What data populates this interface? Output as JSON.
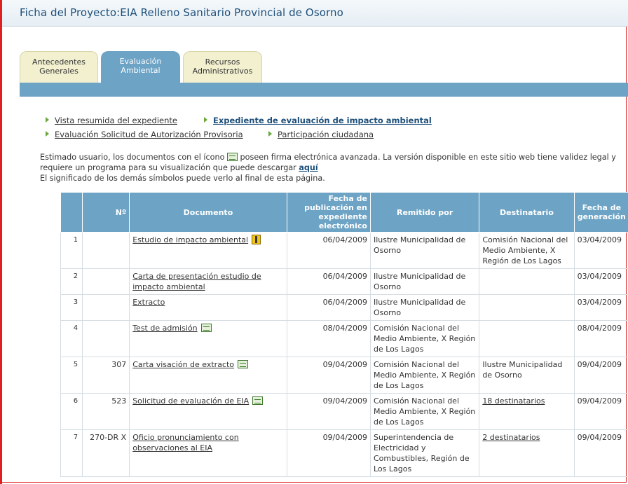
{
  "page": {
    "title": "Ficha del Proyecto:EIA Relleno Sanitario Provincial de Osorno"
  },
  "tabs": [
    {
      "line1": "Antecedentes",
      "line2": "Generales"
    },
    {
      "line1": "Evaluación",
      "line2": "Ambiental"
    },
    {
      "line1": "Recursos",
      "line2": "Administrativos"
    }
  ],
  "links": {
    "vista_resumida": "Vista resumida del expediente",
    "expediente": "Expediente de evaluación de impacto ambiental",
    "solicitud": "Evaluación Solicitud de Autorización Provisoria",
    "participacion": "Participación ciudadana"
  },
  "notice": {
    "part1": "Estimado usuario, los documentos con el ícono",
    "part2": "poseen firma electrónica avanzada. La versión disponible en este sitio web tiene validez legal y requiere un programa para su visualización que puede descargar",
    "aqui": "aquí",
    "line2": "El significado de los demás símbolos puede verlo al final de esta página."
  },
  "table": {
    "headers": [
      "",
      "Nº",
      "Documento",
      "Fecha de publicación en expediente electrónico",
      "Remitido por",
      "Destinatario",
      "Fecha de generación"
    ],
    "rows": [
      {
        "idx": "1",
        "num": "",
        "doc": "Estudio de impacto ambiental",
        "icon": "folder-icon",
        "pub": "06/04/2009",
        "from": "Ilustre Municipalidad de Osorno",
        "to": "Comisión Nacional del Medio Ambiente, X Región de Los Lagos",
        "to_link": false,
        "gen": "03/04/2009"
      },
      {
        "idx": "2",
        "num": "",
        "doc": "Carta de presentación estudio de impacto ambiental",
        "icon": "",
        "pub": "06/04/2009",
        "from": "Ilustre Municipalidad de Osorno",
        "to": "",
        "to_link": false,
        "gen": "03/04/2009"
      },
      {
        "idx": "3",
        "num": "",
        "doc": "Extracto",
        "icon": "",
        "pub": "06/04/2009",
        "from": "Ilustre Municipalidad de Osorno",
        "to": "",
        "to_link": false,
        "gen": "03/04/2009"
      },
      {
        "idx": "4",
        "num": "",
        "doc": "Test de admisión",
        "icon": "signature-icon",
        "pub": "08/04/2009",
        "from": "Comisión Nacional del Medio Ambiente, X Región de Los Lagos",
        "to": "",
        "to_link": false,
        "gen": "08/04/2009"
      },
      {
        "idx": "5",
        "num": "307",
        "doc": "Carta visación de extracto",
        "icon": "signature-icon",
        "pub": "09/04/2009",
        "from": "Comisión Nacional del Medio Ambiente, X Región de Los Lagos",
        "to": "Ilustre Municipalidad de Osorno",
        "to_link": false,
        "gen": "09/04/2009"
      },
      {
        "idx": "6",
        "num": "523",
        "doc": "Solicitud de evaluación de EIA",
        "icon": "signature-icon",
        "pub": "09/04/2009",
        "from": "Comisión Nacional del Medio Ambiente, X Región de Los Lagos",
        "to": "18 destinatarios",
        "to_link": true,
        "gen": "09/04/2009"
      },
      {
        "idx": "7",
        "num": "270-DR X",
        "doc": "Oficio pronunciamiento con observaciones al EIA",
        "icon": "",
        "pub": "09/04/2009",
        "from": "Superintendencia de Electricidad y Combustibles, Región de Los Lagos",
        "to": "2 destinatarios",
        "to_link": true,
        "gen": "09/04/2009"
      }
    ]
  }
}
